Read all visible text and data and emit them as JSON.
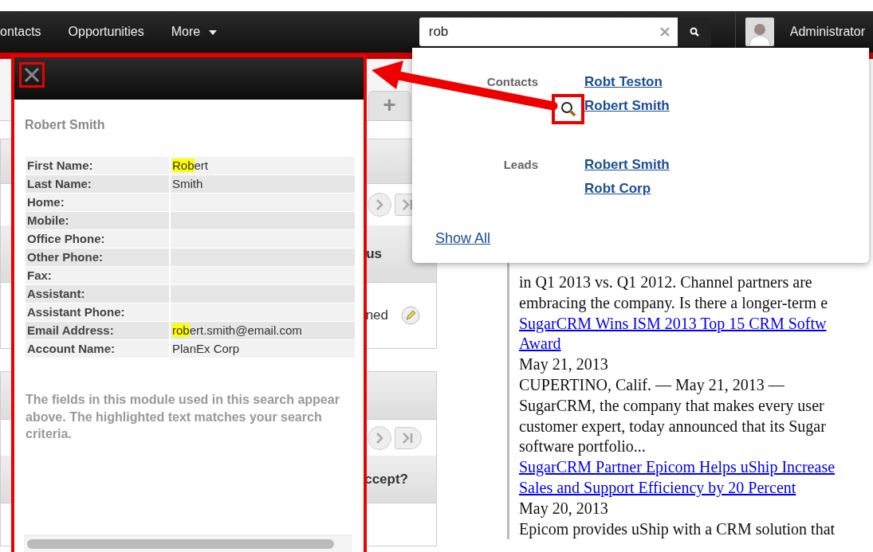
{
  "nav": {
    "items": [
      {
        "label": "ontacts",
        "kind": "plain"
      },
      {
        "label": "Opportunities",
        "kind": "plain"
      },
      {
        "label": "More",
        "kind": "menu"
      }
    ]
  },
  "search": {
    "value": "rob"
  },
  "user": {
    "name": "Administrator"
  },
  "quick_search": {
    "groups": [
      {
        "module": "Contacts",
        "results": [
          {
            "label": "Robt Teston",
            "preview_icon": false
          },
          {
            "label": "Robert Smith",
            "preview_icon": true
          }
        ]
      },
      {
        "module": "Leads",
        "results": [
          {
            "label": "Robert Smith",
            "preview_icon": false
          },
          {
            "label": "Robt Corp",
            "preview_icon": false
          }
        ]
      }
    ],
    "show_all": "Show All"
  },
  "preview": {
    "title": "Robert Smith",
    "fields": [
      {
        "label": "First Name:",
        "match": "Rob",
        "value": "ert"
      },
      {
        "label": "Last Name:",
        "value": "Smith"
      },
      {
        "label": "Home:"
      },
      {
        "label": "Mobile:"
      },
      {
        "label": "Office Phone:"
      },
      {
        "label": "Other Phone:"
      },
      {
        "label": "Fax:"
      },
      {
        "label": "Assistant:"
      },
      {
        "label": "Assistant Phone:"
      },
      {
        "label": "Email Address:",
        "match": "rob",
        "value": "ert.smith@email.com"
      },
      {
        "label": "Account Name:",
        "value": "PlanEx Corp"
      }
    ],
    "note": "The fields in this module used in this search appear above. The highlighted text matches your search criteria."
  },
  "background": {
    "tab": "+",
    "texts": [
      "us",
      "ned",
      "ccept?"
    ]
  },
  "news": {
    "lines": [
      {
        "kind": "text",
        "text": "in Q1 2013 vs. Q1 2012. Channel partners are"
      },
      {
        "kind": "text",
        "text": "embracing the company. Is there a longer-term e"
      },
      {
        "kind": "link",
        "text": "SugarCRM Wins ISM 2013 Top 15 CRM Softw"
      },
      {
        "kind": "link",
        "text": "Award"
      },
      {
        "kind": "text",
        "text": "May 21, 2013"
      },
      {
        "kind": "text",
        "text": "CUPERTINO, Calif. — May 21, 2013 —"
      },
      {
        "kind": "text",
        "text": "SugarCRM, the company that makes every user"
      },
      {
        "kind": "text",
        "text": "customer expert, today announced that its Sugar"
      },
      {
        "kind": "text",
        "text": "software portfolio..."
      },
      {
        "kind": "link",
        "text": "SugarCRM Partner Epicom Helps uShip Increase"
      },
      {
        "kind": "link",
        "text": "Sales and Support Efficiency by 20 Percent"
      },
      {
        "kind": "text",
        "text": "May 20, 2013"
      },
      {
        "kind": "text",
        "text": "Epicom provides uShip with a CRM solution that"
      }
    ]
  }
}
